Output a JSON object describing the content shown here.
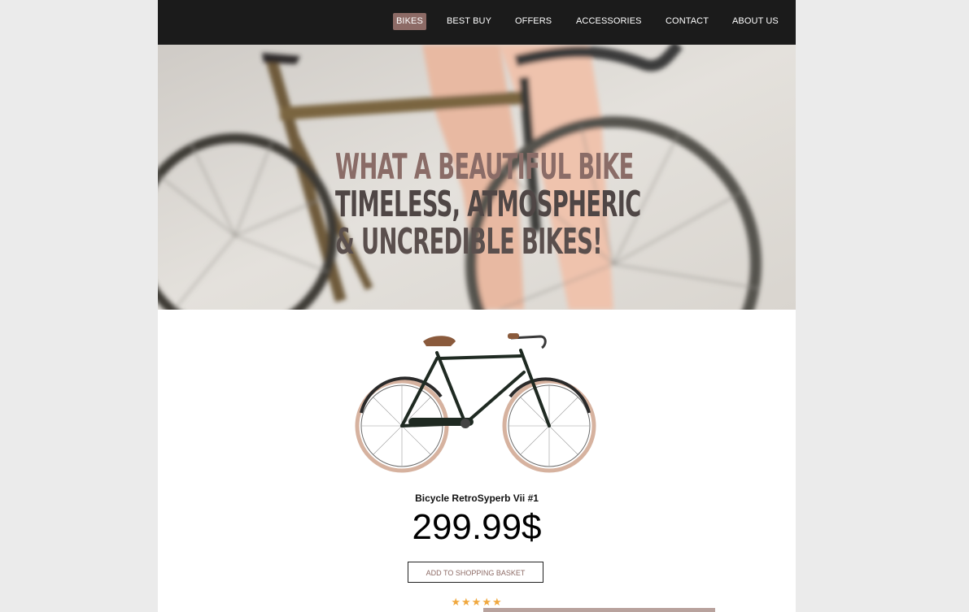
{
  "nav": {
    "items": [
      {
        "label": "BIKES",
        "active": true
      },
      {
        "label": "BEST BUY",
        "active": false
      },
      {
        "label": "OFFERS",
        "active": false
      },
      {
        "label": "ACCESSORIES",
        "active": false
      },
      {
        "label": "CONTACT",
        "active": false
      },
      {
        "label": "ABOUT US",
        "active": false
      }
    ],
    "active_color": "#8d6b66"
  },
  "hero": {
    "line1": "WHAT A BEAUTIFUL BIKE",
    "line2": "TIMELESS, ATMOSPHERIC",
    "line3": "& UNCREDIBLE BIKES!"
  },
  "product": {
    "title": "Bicycle RetroSyperb Vii #1",
    "price": "299.99$",
    "button_label": "ADD TO SHOPPING BASKET",
    "rating": "★★★★★",
    "image_icon": "bicycle-icon"
  },
  "colors": {
    "navbar": "#1b1b1b",
    "accent": "#8d6b66",
    "star": "#f0a83e"
  }
}
